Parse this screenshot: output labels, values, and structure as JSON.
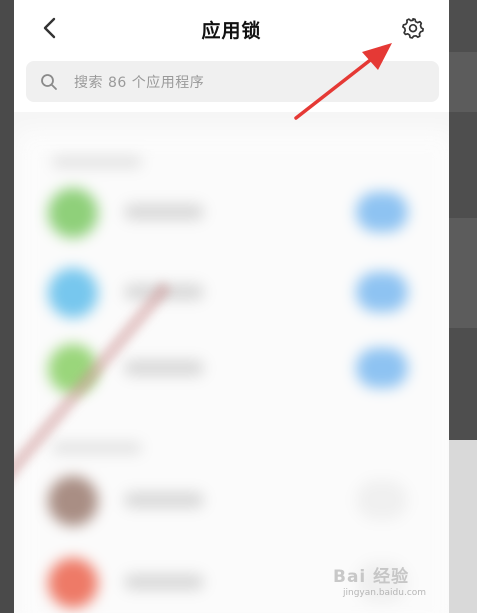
{
  "header": {
    "title": "应用锁",
    "back_icon": "chevron-left-icon",
    "settings_icon": "gear-icon"
  },
  "search": {
    "placeholder": "搜索 86 个应用程序",
    "icon": "search-icon"
  },
  "list": {
    "blurred": true,
    "items": [
      {
        "icon_color": "#8fd07a",
        "toggle_color": "#8ec3f2"
      },
      {
        "icon_color": "#77c7ee",
        "toggle_color": "#8ec3f2"
      },
      {
        "icon_color": "#9ad67b",
        "toggle_color": "#8ec3f2"
      },
      {
        "icon_color": "#a98e84",
        "toggle_color": "#f0f0f0"
      },
      {
        "icon_color": "#ee7a67",
        "toggle_color": "#f0f0f0"
      }
    ]
  },
  "annotation": {
    "arrow_color": "#e53935"
  },
  "watermark": {
    "main": "Bai 经验",
    "sub": "jingyan.baidu.com"
  },
  "colors": {
    "background": "#ffffff",
    "search_bg": "#f0f0f0",
    "list_bg": "#f6f6f6",
    "title": "#111111",
    "placeholder": "#9a9a9a"
  }
}
